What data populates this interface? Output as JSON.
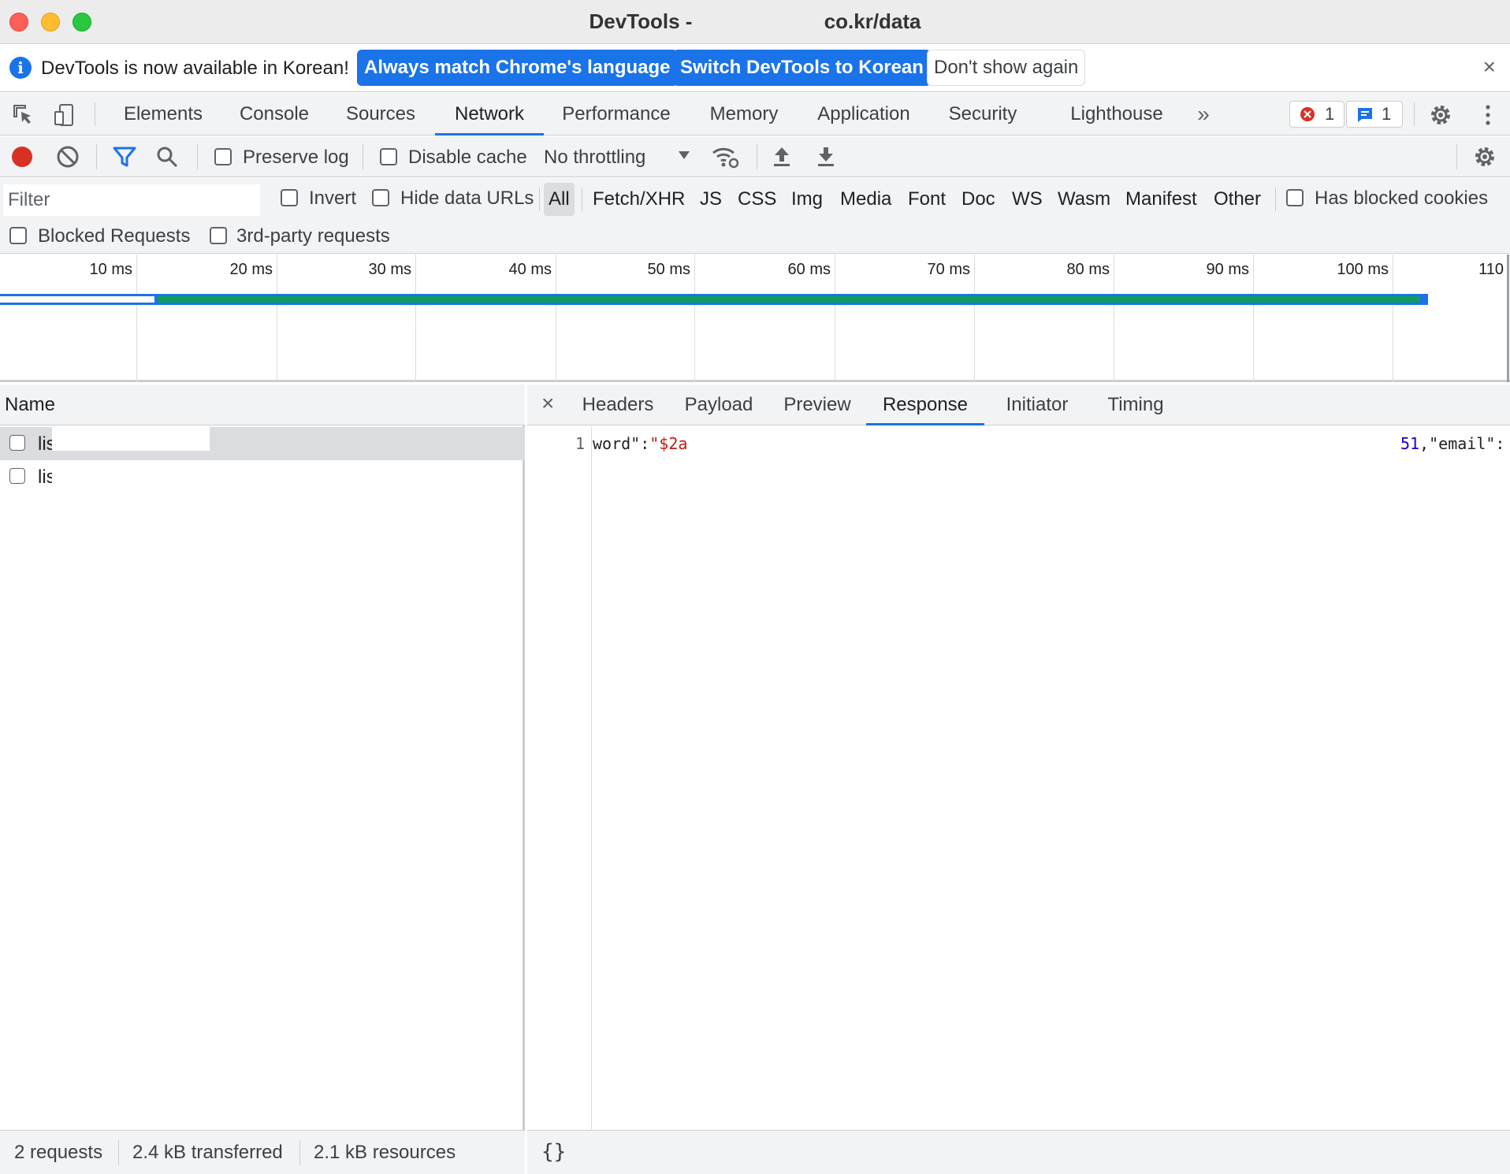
{
  "window": {
    "title": "DevTools - ",
    "title_suffix": "co.kr/data"
  },
  "infobar": {
    "message": "DevTools is now available in Korean!",
    "match_language_label": "Always match Chrome's language",
    "switch_label": "Switch DevTools to Korean",
    "dont_show_label": "Don't show again",
    "close_label": "×"
  },
  "main_tabs": [
    {
      "label": "Elements"
    },
    {
      "label": "Console"
    },
    {
      "label": "Sources"
    },
    {
      "label": "Network"
    },
    {
      "label": "Performance"
    },
    {
      "label": "Memory"
    },
    {
      "label": "Application"
    },
    {
      "label": "Security"
    },
    {
      "label": "Lighthouse"
    }
  ],
  "active_main_tab": "Network",
  "more_tabs_label": "»",
  "badges": {
    "errors": "1",
    "messages": "1"
  },
  "network_toolbar": {
    "preserve_log_label": "Preserve log",
    "disable_cache_label": "Disable cache",
    "throttling_value": "No throttling"
  },
  "filter": {
    "placeholder": "Filter",
    "invert_label": "Invert",
    "hide_data_urls_label": "Hide data URLs",
    "types": [
      "All",
      "Fetch/XHR",
      "JS",
      "CSS",
      "Img",
      "Media",
      "Font",
      "Doc",
      "WS",
      "Wasm",
      "Manifest",
      "Other"
    ],
    "active_type": "All",
    "has_blocked_cookies_label": "Has blocked cookies",
    "blocked_requests_label": "Blocked Requests",
    "third_party_label": "3rd-party requests"
  },
  "timeline": {
    "ticks": [
      "10 ms",
      "20 ms",
      "30 ms",
      "40 ms",
      "50 ms",
      "60 ms",
      "70 ms",
      "80 ms",
      "90 ms",
      "100 ms",
      "110"
    ]
  },
  "requests": {
    "column_name": "Name",
    "rows": [
      {
        "name": "lis",
        "selected": true
      },
      {
        "name": "lis",
        "selected": false
      }
    ]
  },
  "detail": {
    "close_label": "×",
    "tabs": [
      "Headers",
      "Payload",
      "Preview",
      "Response",
      "Initiator",
      "Timing"
    ],
    "active_tab": "Response",
    "response": {
      "line_number": "1",
      "left_key": "word\":",
      "left_value": "\"$2a",
      "right_number": "51",
      "right_rest": ",\"email\":"
    }
  },
  "status": {
    "requests": "2 requests",
    "transferred": "2.4 kB transferred",
    "resources": "2.1 kB resources"
  },
  "pretty_print_label": "{}",
  "colors": {
    "accent": "#1a73e8",
    "record_red": "#d93025",
    "timeline_green": "#0f9d58",
    "json_string": "#c41a16",
    "json_number": "#1c00cf"
  }
}
